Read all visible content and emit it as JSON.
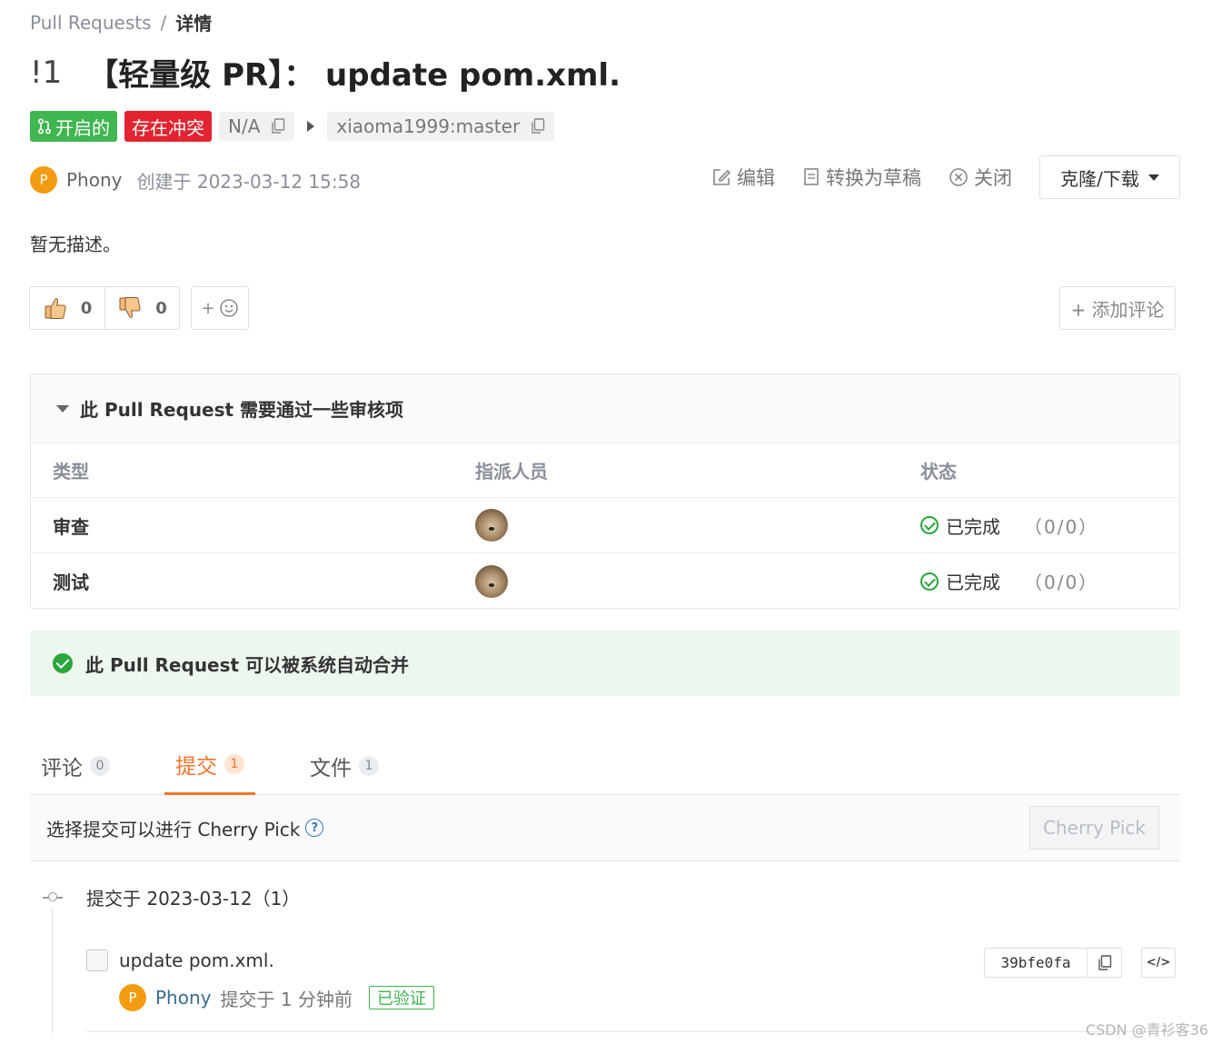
{
  "breadcrumb": {
    "root": "Pull Requests",
    "sep": "/",
    "current": "详情"
  },
  "pr": {
    "number": "!1",
    "title": "【轻量级 PR】： update pom.xml."
  },
  "status": {
    "open_label": "开启的",
    "conflict_label": "存在冲突",
    "source_branch": "N/A",
    "target_branch": "xiaoma1999:master"
  },
  "author": {
    "initial": "P",
    "name": "Phony",
    "created": "创建于 2023-03-12 15:58"
  },
  "actions": {
    "edit": "编辑",
    "draft": "转换为草稿",
    "close": "关闭",
    "clone": "克隆/下载"
  },
  "description": "暂无描述。",
  "reactions": {
    "thumbs_up": "0",
    "thumbs_down": "0",
    "add_emoji": "+"
  },
  "add_comment": "+ 添加评论",
  "review": {
    "heading": "此 Pull Request 需要通过一些审核项",
    "columns": [
      "类型",
      "指派人员",
      "状态"
    ],
    "rows": [
      {
        "type": "审查",
        "status": "已完成",
        "count": "（0/0）"
      },
      {
        "type": "测试",
        "status": "已完成",
        "count": "（0/0）"
      }
    ]
  },
  "merge": {
    "text": "此 Pull Request 可以被系统自动合并",
    "color": "#2aa63a"
  },
  "tabs": [
    {
      "label": "评论",
      "count": "0"
    },
    {
      "label": "提交",
      "count": "1"
    },
    {
      "label": "文件",
      "count": "1"
    }
  ],
  "cherry": {
    "hint": "选择提交可以进行 Cherry Pick",
    "help": "?",
    "button": "Cherry Pick"
  },
  "commits": {
    "group_label": "提交于 2023-03-12（1）",
    "items": [
      {
        "message": "update pom.xml.",
        "author_initial": "P",
        "author": "Phony",
        "when": "提交于 1 分钟前",
        "verified": "已验证",
        "sha": "39bfe0fa",
        "code_icon": "</>"
      }
    ]
  },
  "watermark": "CSDN @青衫客36",
  "colors": {
    "accent": "#f0742b",
    "open": "#3fb650",
    "conflict": "#e1242f",
    "author_avatar": "#f39c12"
  }
}
